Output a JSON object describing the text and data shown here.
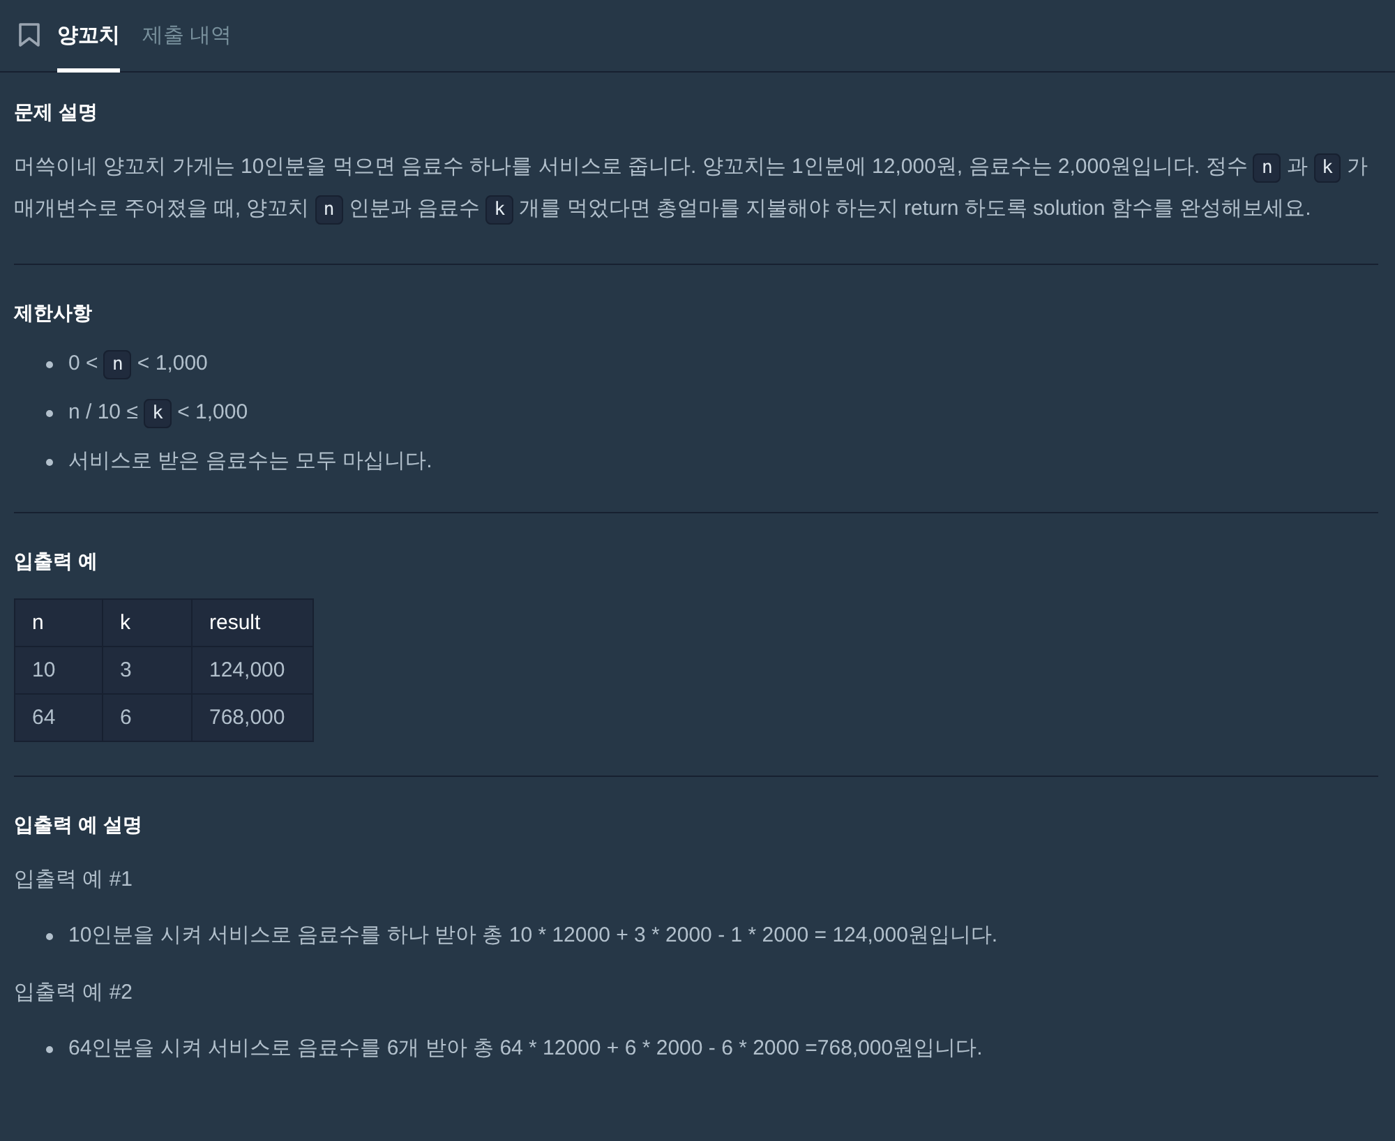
{
  "tabs": [
    {
      "label": "양꼬치",
      "selected": true
    },
    {
      "label": "제출 내역",
      "selected": false
    }
  ],
  "sections": [
    {
      "heading": "문제 설명",
      "blocks": [
        {
          "kind": "paragraph",
          "segments": [
            {
              "kind": "text",
              "text": "머쓱이네 양꼬치 가게는 10인분을 먹으면 음료수 하나를 서비스로 줍니다. 양꼬치는 1인분에 12,000원, 음료수는 2,000원입니다. 정수 "
            },
            {
              "kind": "code",
              "text": "n"
            },
            {
              "kind": "text",
              "text": " 과 "
            },
            {
              "kind": "code",
              "text": "k"
            },
            {
              "kind": "text",
              "text": " 가 매개변수로 주어졌을 때, 양꼬치 "
            },
            {
              "kind": "code",
              "text": "n"
            },
            {
              "kind": "text",
              "text": " 인분과 음료수 "
            },
            {
              "kind": "code",
              "text": "k"
            },
            {
              "kind": "text",
              "text": " 개를 먹었다면 총얼마를 지불해야 하는지 return 하도록 solution 함수를 완성해보세요."
            }
          ]
        }
      ]
    },
    {
      "heading": "제한사항",
      "blocks": [
        {
          "kind": "list",
          "items": [
            [
              {
                "kind": "text",
                "text": "0 < "
              },
              {
                "kind": "code",
                "text": "n"
              },
              {
                "kind": "text",
                "text": " < 1,000"
              }
            ],
            [
              {
                "kind": "text",
                "text": "n / 10 ≤ "
              },
              {
                "kind": "code",
                "text": "k"
              },
              {
                "kind": "text",
                "text": " < 1,000"
              }
            ],
            [
              {
                "kind": "text",
                "text": "서비스로 받은 음료수는 모두 마십니다."
              }
            ]
          ]
        }
      ]
    },
    {
      "heading": "입출력 예",
      "blocks": [
        {
          "kind": "table",
          "columns": [
            "n",
            "k",
            "result"
          ],
          "rows": [
            [
              "10",
              "3",
              "124,000"
            ],
            [
              "64",
              "6",
              "768,000"
            ]
          ]
        }
      ]
    },
    {
      "heading": "입출력 예 설명",
      "blocks": [
        {
          "kind": "paragraph",
          "segments": [
            {
              "kind": "text",
              "text": "입출력 예 #1"
            }
          ]
        },
        {
          "kind": "list",
          "items": [
            [
              {
                "kind": "text",
                "text": "10인분을 시켜 서비스로 음료수를 하나 받아 총 10 * 12000 + 3 * 2000 - 1 * 2000 = 124,000원입니다."
              }
            ]
          ]
        },
        {
          "kind": "paragraph",
          "segments": [
            {
              "kind": "text",
              "text": "입출력 예 #2"
            }
          ]
        },
        {
          "kind": "list",
          "items": [
            [
              {
                "kind": "text",
                "text": "64인분을 시켜 서비스로 음료수를 6개 받아 총 64 * 12000 + 6 * 2000 - 6 * 2000 =768,000원입니다."
              }
            ]
          ]
        }
      ]
    }
  ]
}
